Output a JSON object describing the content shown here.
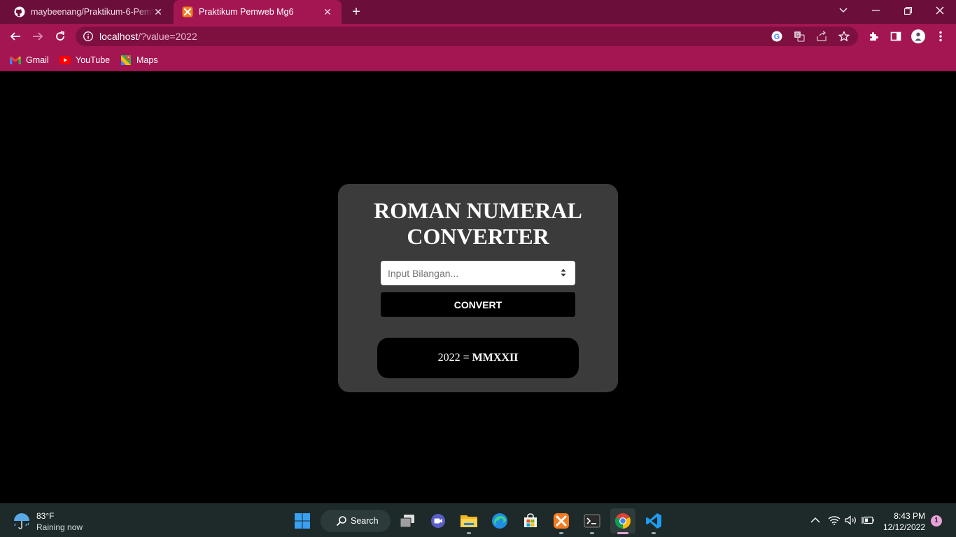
{
  "browser": {
    "tabs": [
      {
        "title": "maybeenang/Praktikum-6-PemWeb",
        "favicon": "github-icon",
        "active": false
      },
      {
        "title": "Praktikum Pemweb Mg6",
        "favicon": "xampp-icon",
        "active": true
      }
    ],
    "url_host": "localhost",
    "url_rest": "/?value=2022",
    "bookmarks": [
      {
        "label": "Gmail",
        "icon": "gmail-icon"
      },
      {
        "label": "YouTube",
        "icon": "youtube-icon"
      },
      {
        "label": "Maps",
        "icon": "maps-icon"
      }
    ],
    "colors": {
      "tabstrip": "#6b0f3a",
      "toolbar": "#a41652",
      "omnibox": "#7e1040"
    }
  },
  "page": {
    "title_line1": "ROMAN NUMERAL",
    "title_line2": "CONVERTER",
    "input_placeholder": "Input Bilangan...",
    "convert_label": "CONVERT",
    "result_number": "2022",
    "result_equals": "=",
    "result_roman": "MMXXII",
    "colors": {
      "background": "#000000",
      "card": "#3b3b3b"
    }
  },
  "taskbar": {
    "weather_temp": "83°F",
    "weather_condition": "Raining now",
    "search_label": "Search",
    "apps": [
      "windows-start-icon",
      "task-view-icon",
      "teams-chat-icon",
      "file-explorer-icon",
      "edge-icon",
      "store-icon",
      "xampp-icon",
      "terminal-icon",
      "chrome-icon",
      "vscode-icon"
    ],
    "time": "8:43 PM",
    "date": "12/12/2022",
    "notification_count": "1"
  }
}
